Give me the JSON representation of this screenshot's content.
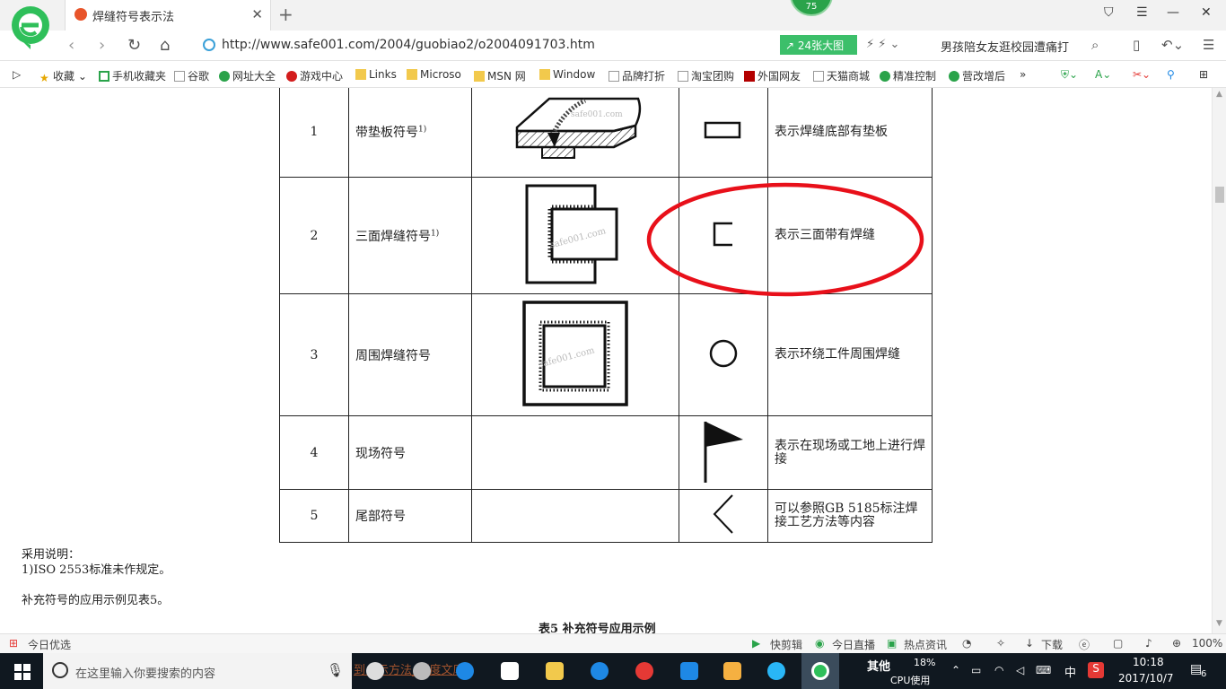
{
  "browser": {
    "tab_title": "焊缝符号表示法",
    "badge_count": "75",
    "url": "http://www.safe001.com/2004/guobiao2/o2004091703.htm",
    "bigpic_label": "24张大图",
    "hot_search": "男孩陪女友逛校园遭痛打"
  },
  "bookmarks": [
    {
      "label": "收藏",
      "icon": "star-icon"
    },
    {
      "label": "手机收藏夹",
      "icon": "phone-icon"
    },
    {
      "label": "谷歌",
      "icon": "page-icon"
    },
    {
      "label": "网址大全",
      "icon": "globe-icon"
    },
    {
      "label": "游戏中心",
      "icon": "game-icon"
    },
    {
      "label": "Links",
      "icon": "folder-icon"
    },
    {
      "label": "Microso",
      "icon": "folder-icon"
    },
    {
      "label": "MSN 网",
      "icon": "folder-icon"
    },
    {
      "label": "Window",
      "icon": "folder-icon"
    },
    {
      "label": "品牌打折",
      "icon": "page-icon"
    },
    {
      "label": "淘宝团购",
      "icon": "page-icon"
    },
    {
      "label": "外国网友",
      "icon": "flag-icon"
    },
    {
      "label": "天猫商城",
      "icon": "page-icon"
    },
    {
      "label": "精准控制",
      "icon": "chat-icon"
    },
    {
      "label": "营改增后",
      "icon": "chat-icon"
    }
  ],
  "table": {
    "rows": [
      {
        "no": "1",
        "name": "带垫板符号",
        "sup": "1)",
        "desc": "表示焊缝底部有垫板"
      },
      {
        "no": "2",
        "name": "三面焊缝符号",
        "sup": "1)",
        "desc": "表示三面带有焊缝"
      },
      {
        "no": "3",
        "name": "周围焊缝符号",
        "sup": "",
        "desc": "表示环绕工件周围焊缝"
      },
      {
        "no": "4",
        "name": "现场符号",
        "sup": "",
        "desc": "表示在现场或工地上进行焊接"
      },
      {
        "no": "5",
        "name": "尾部符号",
        "sup": "",
        "desc": "可以参照GB 5185标注焊接工艺方法等内容"
      }
    ],
    "watermark": "safe001.com"
  },
  "notes": {
    "heading": "采用说明：",
    "note1": "1)ISO 2553标准未作规定。",
    "para": "补充符号的应用示例见表5。",
    "next_table_title": "表5 补充符号应用示例"
  },
  "statusbar": {
    "left": "今日优选",
    "items": [
      "快剪辑",
      "今日直播",
      "热点资讯"
    ],
    "download": "下载",
    "zoom": "100%"
  },
  "taskbar": {
    "search_placeholder": "在这里输入你要搜索的内容",
    "cpu_percent": "18%",
    "cpu_label": "CPU使用",
    "ime": "中",
    "time": "10:18",
    "date": "2017/10/7",
    "notification_count": "6",
    "bg_text_1": "其他",
    "bg_link": "到…示方法_百度文库"
  },
  "colors": {
    "highlight_ellipse": "#e8101a",
    "accent_green": "#3cbf6a"
  }
}
